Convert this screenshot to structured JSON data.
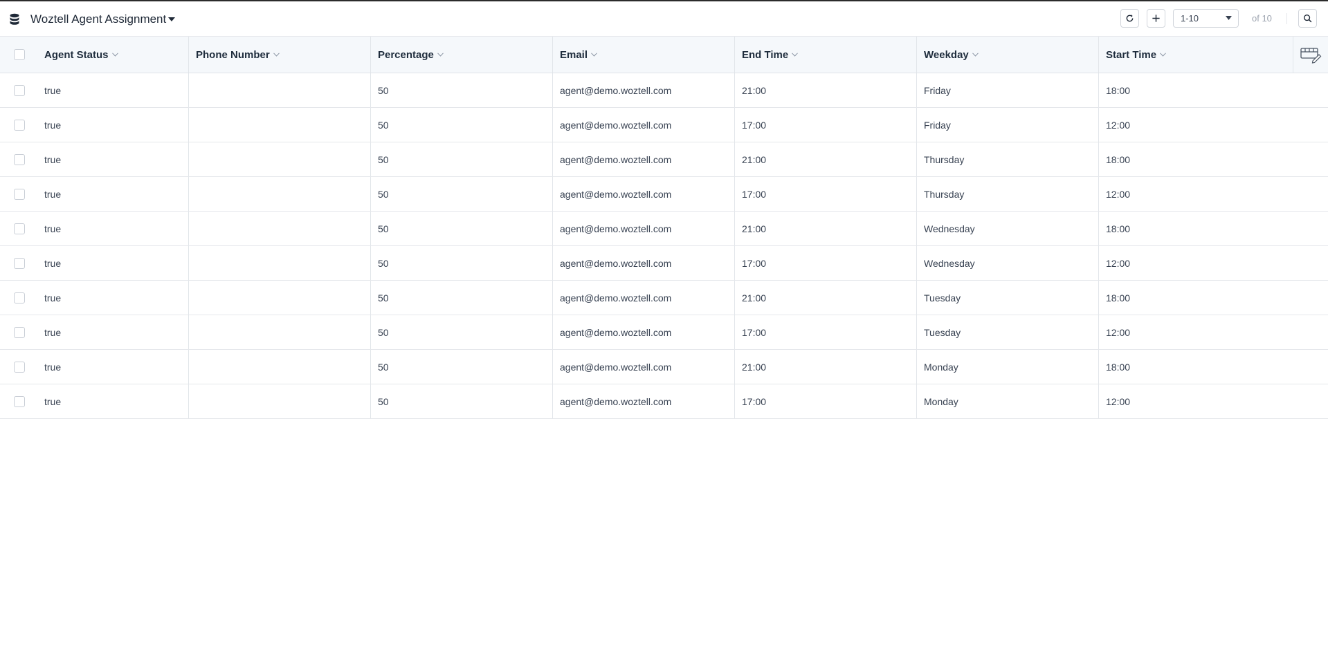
{
  "header": {
    "title": "Woztell Agent Assignment",
    "range_value": "1-10",
    "of_total": "of 10"
  },
  "icons": {
    "db": "database-icon",
    "caret": "caret-down-icon",
    "refresh": "refresh-icon",
    "add": "plus-icon",
    "search": "search-icon",
    "edit": "table-edit-icon",
    "sort": "chevron-down-icon"
  },
  "table": {
    "columns": [
      "Agent Status",
      "Phone Number",
      "Percentage",
      "Email",
      "End Time",
      "Weekday",
      "Start Time"
    ],
    "rows": [
      {
        "status": "true",
        "phone": "",
        "percentage": "50",
        "email": "agent@demo.woztell.com",
        "end": "21:00",
        "weekday": "Friday",
        "start": "18:00"
      },
      {
        "status": "true",
        "phone": "",
        "percentage": "50",
        "email": "agent@demo.woztell.com",
        "end": "17:00",
        "weekday": "Friday",
        "start": "12:00"
      },
      {
        "status": "true",
        "phone": "",
        "percentage": "50",
        "email": "agent@demo.woztell.com",
        "end": "21:00",
        "weekday": "Thursday",
        "start": "18:00"
      },
      {
        "status": "true",
        "phone": "",
        "percentage": "50",
        "email": "agent@demo.woztell.com",
        "end": "17:00",
        "weekday": "Thursday",
        "start": "12:00"
      },
      {
        "status": "true",
        "phone": "",
        "percentage": "50",
        "email": "agent@demo.woztell.com",
        "end": "21:00",
        "weekday": "Wednesday",
        "start": "18:00"
      },
      {
        "status": "true",
        "phone": "",
        "percentage": "50",
        "email": "agent@demo.woztell.com",
        "end": "17:00",
        "weekday": "Wednesday",
        "start": "12:00"
      },
      {
        "status": "true",
        "phone": "",
        "percentage": "50",
        "email": "agent@demo.woztell.com",
        "end": "21:00",
        "weekday": "Tuesday",
        "start": "18:00"
      },
      {
        "status": "true",
        "phone": "",
        "percentage": "50",
        "email": "agent@demo.woztell.com",
        "end": "17:00",
        "weekday": "Tuesday",
        "start": "12:00"
      },
      {
        "status": "true",
        "phone": "",
        "percentage": "50",
        "email": "agent@demo.woztell.com",
        "end": "21:00",
        "weekday": "Monday",
        "start": "18:00"
      },
      {
        "status": "true",
        "phone": "",
        "percentage": "50",
        "email": "agent@demo.woztell.com",
        "end": "17:00",
        "weekday": "Monday",
        "start": "12:00"
      }
    ]
  }
}
